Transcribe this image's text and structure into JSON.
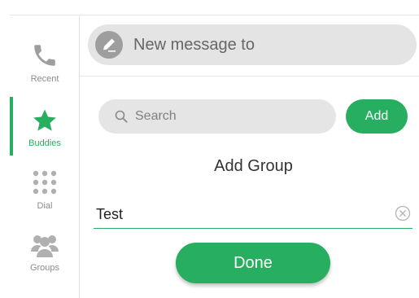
{
  "sidebar": {
    "items": [
      {
        "label": "Recent",
        "icon": "phone-icon",
        "active": false
      },
      {
        "label": "Buddies",
        "icon": "star-icon",
        "active": true
      },
      {
        "label": "Dial",
        "icon": "dialpad-icon",
        "active": false
      },
      {
        "label": "Groups",
        "icon": "groups-icon",
        "active": false
      }
    ]
  },
  "header": {
    "new_message_label": "New message to",
    "icon": "pencil-icon"
  },
  "search": {
    "placeholder": "Search",
    "icon": "search-icon"
  },
  "add_button_label": "Add",
  "dialog": {
    "title": "Add Group",
    "group_name_value": "Test",
    "clear_icon": "clear-icon",
    "done_label": "Done"
  },
  "colors": {
    "accent": "#27ae60",
    "inactive": "#9e9e9e",
    "pill_background": "#e5e5e5"
  }
}
